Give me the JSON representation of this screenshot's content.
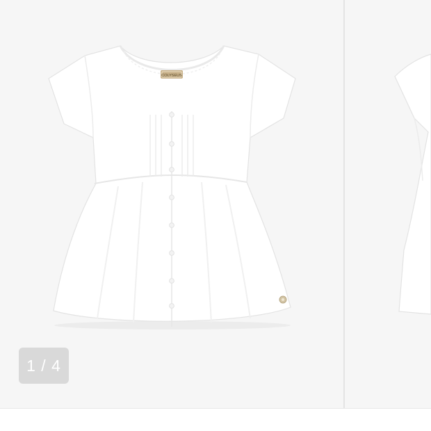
{
  "gallery": {
    "counter": "1 / 4",
    "brand_tag": "COLYSEUS",
    "colors": {
      "background": "#f6f6f6",
      "counter_bg": "#d9d9d9",
      "garment": "#ffffff",
      "tag": "#c9b28a"
    },
    "icons": [
      "product-photo",
      "brand-label-icon",
      "charm-icon"
    ]
  }
}
